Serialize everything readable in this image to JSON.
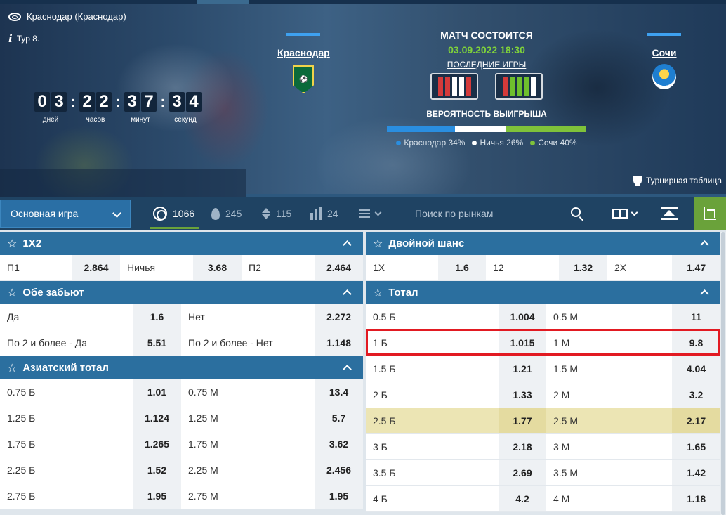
{
  "match": {
    "location": "Краснодар (Краснодар)",
    "round": "Тур 8.",
    "status": "МАТЧ СОСТОИТСЯ",
    "datetime": "03.09.2022 18:30",
    "last_games_label": "ПОСЛЕДНИЕ ИГРЫ",
    "probability_title": "ВЕРОЯТНОСТЬ ВЫИГРЫША",
    "standings_label": "Турнирная таблица",
    "home": {
      "name": "Краснодар",
      "form": [
        "L",
        "L",
        "D",
        "D",
        "L"
      ]
    },
    "away": {
      "name": "Сочи",
      "form": [
        "L",
        "W",
        "W",
        "W",
        "D"
      ]
    },
    "countdown": {
      "days": [
        "0",
        "3"
      ],
      "hours": [
        "2",
        "2"
      ],
      "minutes": [
        "3",
        "7"
      ],
      "seconds": [
        "3",
        "4"
      ],
      "days_label": "дней",
      "hours_label": "часов",
      "minutes_label": "минут",
      "seconds_label": "секунд"
    },
    "probability": [
      {
        "label": "Краснодар 34%",
        "value": 34,
        "color": "#2a8ee0"
      },
      {
        "label": "Ничья 26%",
        "value": 26,
        "color": "#ffffff"
      },
      {
        "label": "Сочи 40%",
        "value": 40,
        "color": "#7fc23a"
      }
    ]
  },
  "toolbar": {
    "main_select": "Основная игра",
    "counts": {
      "all": "1066",
      "hot": "245",
      "updown": "115",
      "stats": "24"
    },
    "search_placeholder": "Поиск по рынкам"
  },
  "markets_left": {
    "m1x2": {
      "title": "1X2",
      "row": [
        {
          "label": "П1",
          "odd": "2.864"
        },
        {
          "label": "Ничья",
          "odd": "3.68"
        },
        {
          "label": "П2",
          "odd": "2.464"
        }
      ]
    },
    "btts": {
      "title": "Обе забьют",
      "rows": [
        [
          {
            "label": "Да",
            "odd": "1.6"
          },
          {
            "label": "Нет",
            "odd": "2.272"
          }
        ],
        [
          {
            "label": "По 2 и более - Да",
            "odd": "5.51"
          },
          {
            "label": "По 2 и более - Нет",
            "odd": "1.148"
          }
        ]
      ]
    },
    "asian": {
      "title": "Азиатский тотал",
      "rows": [
        [
          {
            "label": "0.75 Б",
            "odd": "1.01"
          },
          {
            "label": "0.75 М",
            "odd": "13.4"
          }
        ],
        [
          {
            "label": "1.25 Б",
            "odd": "1.124"
          },
          {
            "label": "1.25 М",
            "odd": "5.7"
          }
        ],
        [
          {
            "label": "1.75 Б",
            "odd": "1.265"
          },
          {
            "label": "1.75 М",
            "odd": "3.62"
          }
        ],
        [
          {
            "label": "2.25 Б",
            "odd": "1.52"
          },
          {
            "label": "2.25 М",
            "odd": "2.456"
          }
        ],
        [
          {
            "label": "2.75 Б",
            "odd": "1.95"
          },
          {
            "label": "2.75 М",
            "odd": "1.95"
          }
        ]
      ]
    }
  },
  "markets_right": {
    "double": {
      "title": "Двойной шанс",
      "row": [
        {
          "label": "1X",
          "odd": "1.6"
        },
        {
          "label": "12",
          "odd": "1.32"
        },
        {
          "label": "2X",
          "odd": "1.47"
        }
      ]
    },
    "total": {
      "title": "Тотал",
      "rows": [
        [
          {
            "label": "0.5 Б",
            "odd": "1.004"
          },
          {
            "label": "0.5 М",
            "odd": "11"
          }
        ],
        [
          {
            "label": "1 Б",
            "odd": "1.015"
          },
          {
            "label": "1 М",
            "odd": "9.8"
          }
        ],
        [
          {
            "label": "1.5 Б",
            "odd": "1.21"
          },
          {
            "label": "1.5 М",
            "odd": "4.04"
          }
        ],
        [
          {
            "label": "2 Б",
            "odd": "1.33"
          },
          {
            "label": "2 М",
            "odd": "3.2"
          }
        ],
        [
          {
            "label": "2.5 Б",
            "odd": "1.77"
          },
          {
            "label": "2.5 М",
            "odd": "2.17"
          }
        ],
        [
          {
            "label": "3 Б",
            "odd": "2.18"
          },
          {
            "label": "3 М",
            "odd": "1.65"
          }
        ],
        [
          {
            "label": "3.5 Б",
            "odd": "2.69"
          },
          {
            "label": "3.5 М",
            "odd": "1.42"
          }
        ],
        [
          {
            "label": "4 Б",
            "odd": "4.2"
          },
          {
            "label": "4 М",
            "odd": "1.18"
          }
        ]
      ]
    }
  }
}
